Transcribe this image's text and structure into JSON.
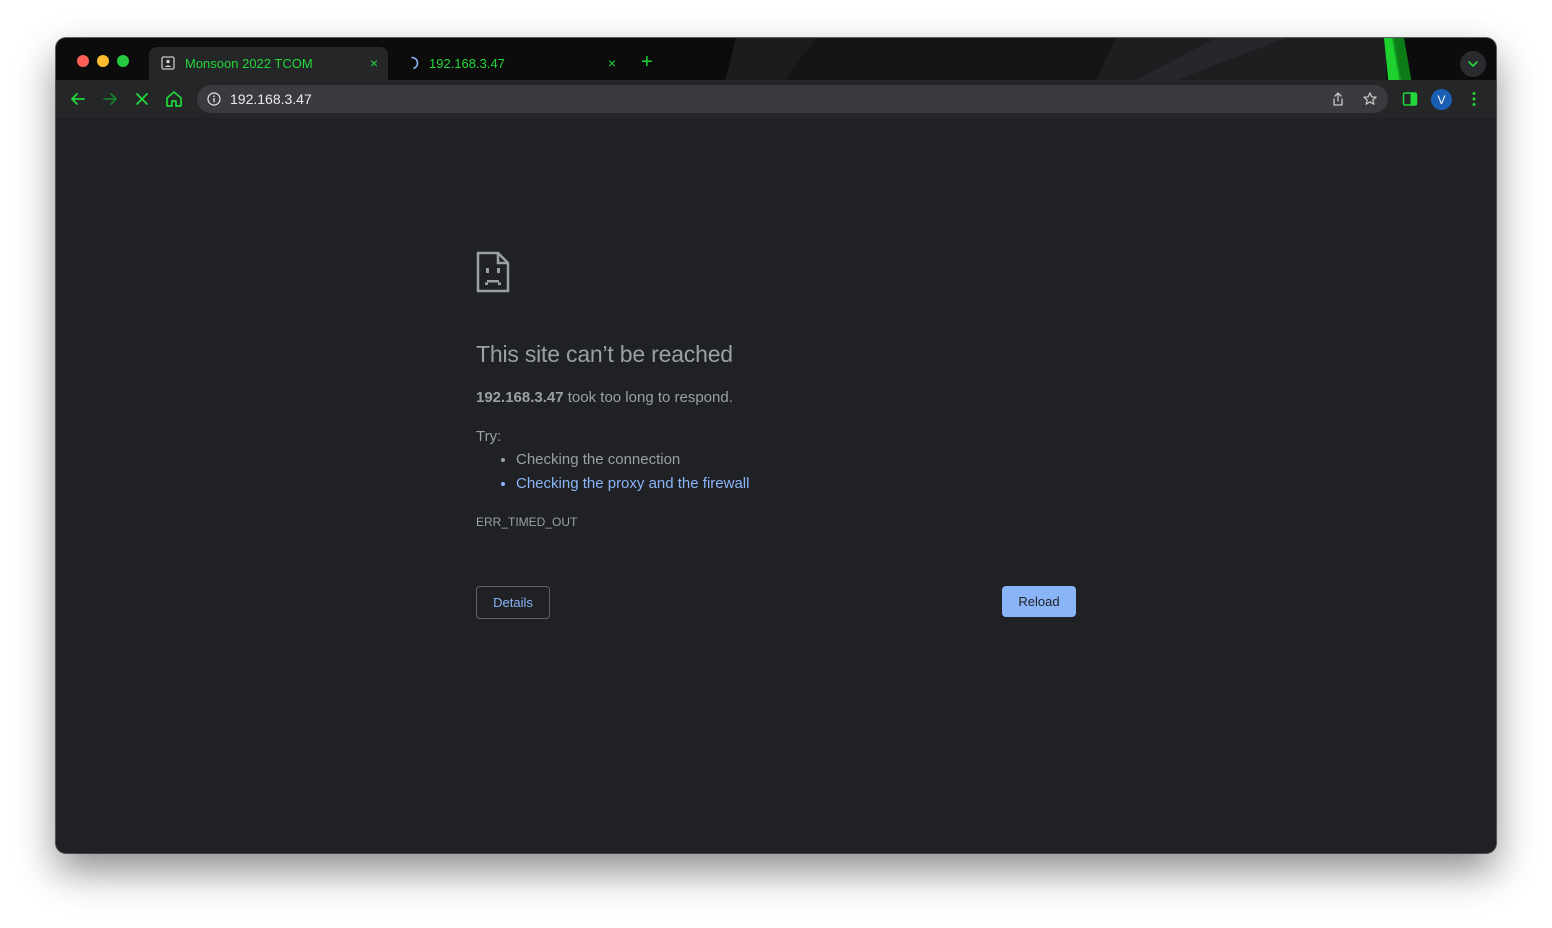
{
  "tabs": [
    {
      "title": "Monsoon 2022 TCOM",
      "close": "×",
      "active": true
    },
    {
      "title": "192.168.3.47",
      "close": "×",
      "active": false
    }
  ],
  "new_tab": "+",
  "address_bar": {
    "url": "192.168.3.47"
  },
  "profile": {
    "initial": "V"
  },
  "error_page": {
    "title": "This site can’t be reached",
    "host": "192.168.3.47",
    "description": " took too long to respond.",
    "try_label": "Try:",
    "suggestions": [
      "Checking the connection",
      "Checking the proxy and the firewall"
    ],
    "error_code": "ERR_TIMED_OUT",
    "details_label": "Details",
    "reload_label": "Reload"
  },
  "colors": {
    "accent_green": "#22d83a",
    "page_background": "#202124",
    "link_blue": "#8ab4f8",
    "text_gray": "#9aa0a6"
  },
  "icons": [
    "back-icon",
    "forward-icon",
    "stop-icon",
    "home-icon",
    "info-icon",
    "share-icon",
    "bookmark-star-icon",
    "side-panel-icon",
    "menu-icon",
    "tab-search-icon",
    "sad-page-icon",
    "loading-spinner-icon",
    "page-favicon-icon"
  ]
}
